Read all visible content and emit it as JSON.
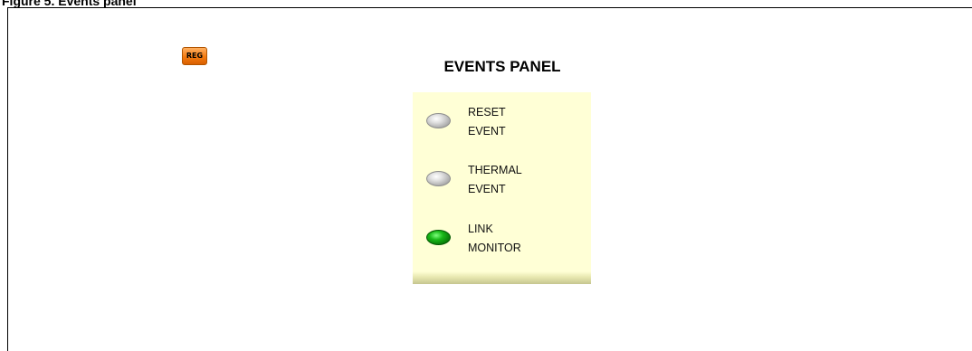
{
  "figure": {
    "caption": "Figure 5.   Events panel"
  },
  "reg_button": {
    "label": "REG",
    "color": "#f47a10"
  },
  "panel": {
    "title": "EVENTS PANEL",
    "background": "#ffffd6",
    "events": [
      {
        "line1": "RESET",
        "line2": "EVENT",
        "status": "off",
        "color": "#c0c0c0"
      },
      {
        "line1": "THERMAL",
        "line2": "EVENT",
        "status": "off",
        "color": "#c0c0c0"
      },
      {
        "line1": "LINK",
        "line2": "MONITOR",
        "status": "on",
        "color": "#18b818"
      }
    ]
  }
}
